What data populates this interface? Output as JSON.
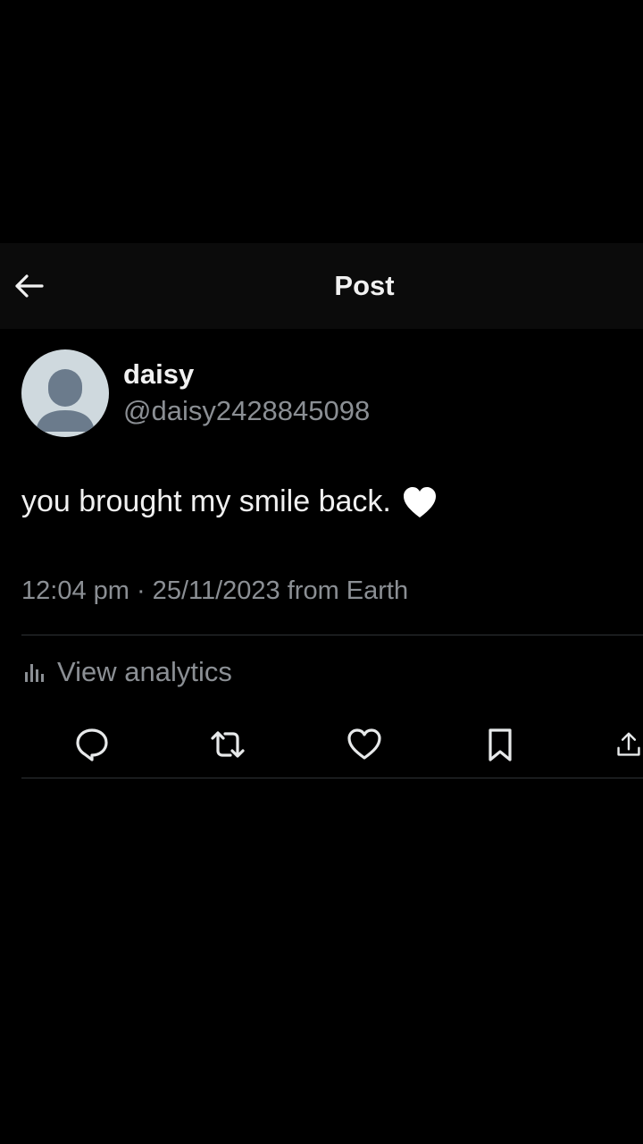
{
  "header": {
    "title": "Post",
    "back_icon": "arrow-left-icon"
  },
  "post": {
    "author": {
      "display_name": "daisy",
      "handle": "@daisy2428845098",
      "avatar_icon": "default-avatar-icon"
    },
    "text": "you brought my smile back.",
    "emoji": "white-heart",
    "meta": "12:04 pm · 25/11/2023 from Earth",
    "analytics_label": "View analytics"
  },
  "actions": [
    {
      "name": "reply",
      "icon": "reply-icon"
    },
    {
      "name": "repost",
      "icon": "repost-icon"
    },
    {
      "name": "like",
      "icon": "heart-icon"
    },
    {
      "name": "bookmark",
      "icon": "bookmark-icon"
    },
    {
      "name": "share",
      "icon": "share-icon"
    }
  ],
  "colors": {
    "background": "#000000",
    "header_background": "#0b0b0b",
    "primary_text": "#f1f1f1",
    "secondary_text": "#8b8f94",
    "divider": "#2f3336",
    "avatar_background": "#cfd9de",
    "avatar_figure": "#6b7b8c"
  }
}
